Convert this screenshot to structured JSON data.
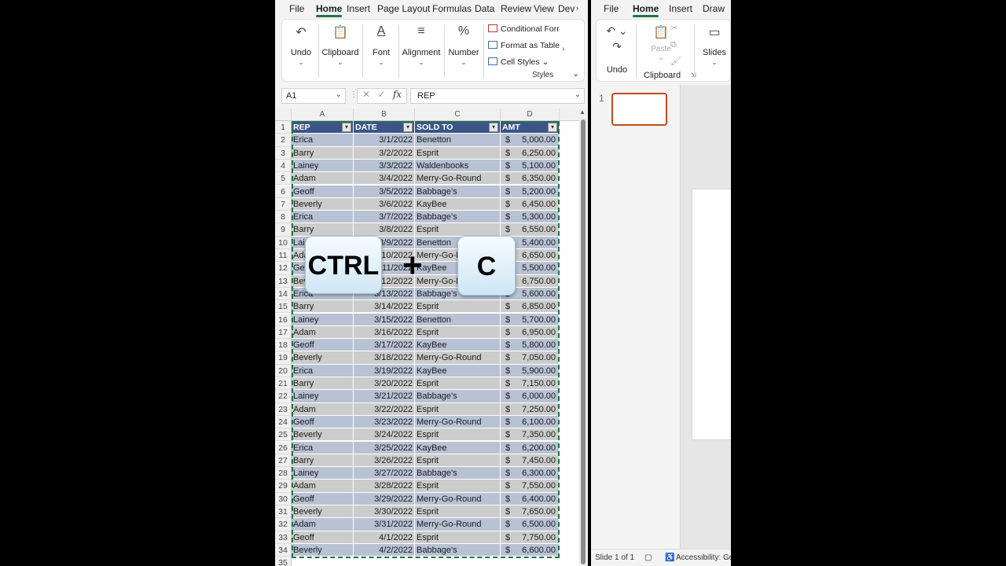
{
  "excel": {
    "tabs": [
      "File",
      "Home",
      "Insert",
      "Page Layout",
      "Formulas",
      "Data",
      "Review",
      "View",
      "Dev"
    ],
    "active_tab": "Home",
    "ribbon": {
      "undo": "Undo",
      "clipboard": "Clipboard",
      "font": "Font",
      "alignment": "Alignment",
      "number": "Number",
      "conditional_formatting": "Conditional Forr",
      "format_as_table": "Format as Table",
      "cell_styles": "Cell Styles",
      "styles_group": "Styles"
    },
    "name_box": "A1",
    "formula_value": "REP",
    "fx": "fx",
    "columns": [
      "A",
      "B",
      "C",
      "D"
    ],
    "table": {
      "headers": [
        "REP",
        "DATE",
        "SOLD TO",
        "AMT"
      ],
      "currency": "$",
      "rows": [
        [
          "Erica",
          "3/1/2022",
          "Benetton",
          "5,000.00"
        ],
        [
          "Barry",
          "3/2/2022",
          "Esprit",
          "6,250.00"
        ],
        [
          "Lainey",
          "3/3/2022",
          "Waldenbooks",
          "5,100.00"
        ],
        [
          "Adam",
          "3/4/2022",
          "Merry-Go-Round",
          "6,350.00"
        ],
        [
          "Geoff",
          "3/5/2022",
          "Babbage's",
          "5,200.00"
        ],
        [
          "Beverly",
          "3/6/2022",
          "KayBee",
          "6,450.00"
        ],
        [
          "Erica",
          "3/7/2022",
          "Babbage's",
          "5,300.00"
        ],
        [
          "Barry",
          "3/8/2022",
          "Esprit",
          "6,550.00"
        ],
        [
          "Lainey",
          "3/9/2022",
          "Benetton",
          "5,400.00"
        ],
        [
          "Adam",
          "3/10/2022",
          "Merry-Go-Round",
          "6,650.00"
        ],
        [
          "Geoff",
          "3/11/2022",
          "KayBee",
          "5,500.00"
        ],
        [
          "Beverly",
          "3/12/2022",
          "Merry-Go-Round",
          "6,750.00"
        ],
        [
          "Erica",
          "3/13/2022",
          "Babbage's",
          "5,600.00"
        ],
        [
          "Barry",
          "3/14/2022",
          "Esprit",
          "6,850.00"
        ],
        [
          "Lainey",
          "3/15/2022",
          "Benetton",
          "5,700.00"
        ],
        [
          "Adam",
          "3/16/2022",
          "Esprit",
          "6,950.00"
        ],
        [
          "Geoff",
          "3/17/2022",
          "KayBee",
          "5,800.00"
        ],
        [
          "Beverly",
          "3/18/2022",
          "Merry-Go-Round",
          "7,050.00"
        ],
        [
          "Erica",
          "3/19/2022",
          "KayBee",
          "5,900.00"
        ],
        [
          "Barry",
          "3/20/2022",
          "Esprit",
          "7,150.00"
        ],
        [
          "Lainey",
          "3/21/2022",
          "Babbage's",
          "6,000.00"
        ],
        [
          "Adam",
          "3/22/2022",
          "Esprit",
          "7,250.00"
        ],
        [
          "Geoff",
          "3/23/2022",
          "Merry-Go-Round",
          "6,100.00"
        ],
        [
          "Beverly",
          "3/24/2022",
          "Esprit",
          "7,350.00"
        ],
        [
          "Erica",
          "3/25/2022",
          "KayBee",
          "6,200.00"
        ],
        [
          "Barry",
          "3/26/2022",
          "Esprit",
          "7,450.00"
        ],
        [
          "Lainey",
          "3/27/2022",
          "Babbage's",
          "6,300.00"
        ],
        [
          "Adam",
          "3/28/2022",
          "Esprit",
          "7,550.00"
        ],
        [
          "Geoff",
          "3/29/2022",
          "Merry-Go-Round",
          "6,400.00"
        ],
        [
          "Beverly",
          "3/30/2022",
          "Esprit",
          "7,650.00"
        ],
        [
          "Adam",
          "3/31/2022",
          "Merry-Go-Round",
          "6,500.00"
        ],
        [
          "Geoff",
          "4/1/2022",
          "Esprit",
          "7,750.00"
        ],
        [
          "Beverly",
          "4/2/2022",
          "Babbage's",
          "6,600.00"
        ]
      ],
      "partial_row_number": "35"
    }
  },
  "overlay": {
    "key1": "CTRL",
    "plus": "+",
    "key2": "C"
  },
  "ppt": {
    "tabs": [
      "File",
      "Home",
      "Insert",
      "Draw"
    ],
    "active_tab": "Home",
    "ribbon": {
      "undo": "Undo",
      "paste": "Paste",
      "clipboard": "Clipboard",
      "slides": "Slides"
    },
    "slide_number": "1",
    "status_slide": "Slide 1 of 1",
    "status_accessibility": "Accessibility: Goo"
  },
  "colors": {
    "excel_green": "#217346",
    "table_header": "#3b5588",
    "band_blue": "#b8c2d4",
    "band_gray": "#cccccc",
    "ppt_accent": "#c04a1a"
  }
}
